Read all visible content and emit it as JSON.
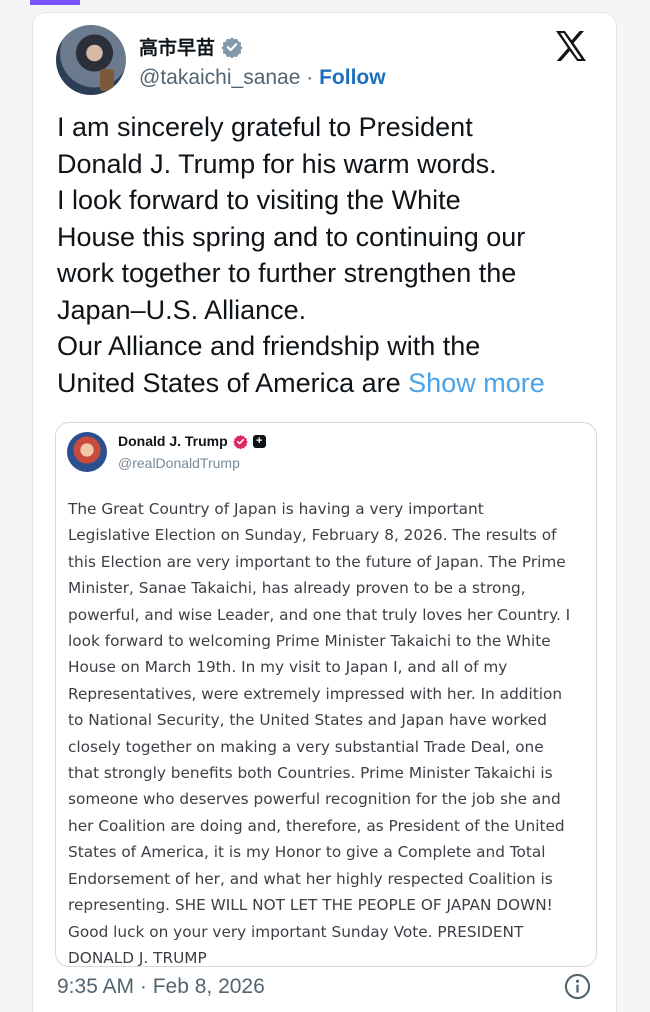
{
  "post": {
    "author": {
      "name": "高市早苗",
      "handle": "@takaichi_sanae",
      "separator": " · ",
      "follow_label": "Follow"
    },
    "lines": [
      "I am sincerely grateful to President",
      "Donald J. Trump for his warm words.",
      "I look forward to visiting the White",
      "House this spring and to continuing our",
      "work together to further strengthen the",
      "Japan–U.S. Alliance.",
      "Our Alliance and friendship with the"
    ],
    "last_line": "United States of America are ",
    "show_more_label": "Show more",
    "timestamp": "9:35 AM · Feb 8, 2026"
  },
  "quote": {
    "name": "Donald J. Trump",
    "handle": "@realDonaldTrump",
    "lines": [
      "The Great Country of Japan is having a very important",
      "Legislative Election on Sunday, February 8, 2026. The results of",
      "this Election are very important to the future of Japan. The Prime",
      "Minister, Sanae Takaichi, has already proven to be a strong,",
      "powerful, and wise Leader, and one that truly loves her Country. I",
      "look forward to welcoming Prime Minister Takaichi to the White",
      "House on March 19th. In my visit to Japan I, and all of my",
      "Representatives, were extremely impressed with her. In addition",
      "to National Security, the United States and Japan have worked",
      "closely together on making a very substantial Trade Deal, one",
      "that strongly benefits both Countries. Prime Minister Takaichi is",
      "someone who deserves powerful recognition for the job she and",
      "her Coalition are doing and, therefore, as President of the United",
      "States of America, it is my Honor to give a Complete and Total",
      "Endorsement of her, and what her highly respected Coalition is",
      "representing. SHE WILL NOT LET THE PEOPLE OF JAPAN DOWN!",
      "Good luck on your very important Sunday Vote. PRESIDENT",
      "DONALD J. TRUMP"
    ]
  },
  "icons": {
    "verified": "verified-badge-icon",
    "logo": "x-logo-icon",
    "info": "info-icon"
  },
  "colors": {
    "follow": "#1d6fbe",
    "show_more": "#4aa3e8",
    "verified_gray": "#829aab",
    "quote_badge": "#e0245e",
    "accent": "#7856ff"
  }
}
